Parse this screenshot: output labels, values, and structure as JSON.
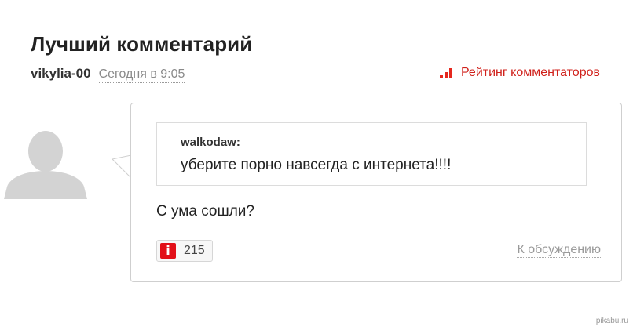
{
  "header": {
    "title": "Лучший комментарий",
    "author": "vikylia-00",
    "date": "Сегодня в 9:05",
    "rating_link": "Рейтинг комментаторов"
  },
  "comment": {
    "quote_author": "walkodaw:",
    "quote_text": "уберите порно навсегда с интернета!!!!",
    "text": "С ума сошли?",
    "votes_icon": "i",
    "votes": "215",
    "discussion_link": "К обсуждению"
  },
  "watermark": "pikabu.ru",
  "colors": {
    "accent": "#d0211b",
    "vote_badge": "#e20f18",
    "muted_text": "#8a8a8a",
    "border": "#cfcfcf"
  },
  "icons": {
    "rating": "rating-bars-icon",
    "avatar": "user-avatar-placeholder-icon",
    "votes": "info-badge-icon"
  }
}
